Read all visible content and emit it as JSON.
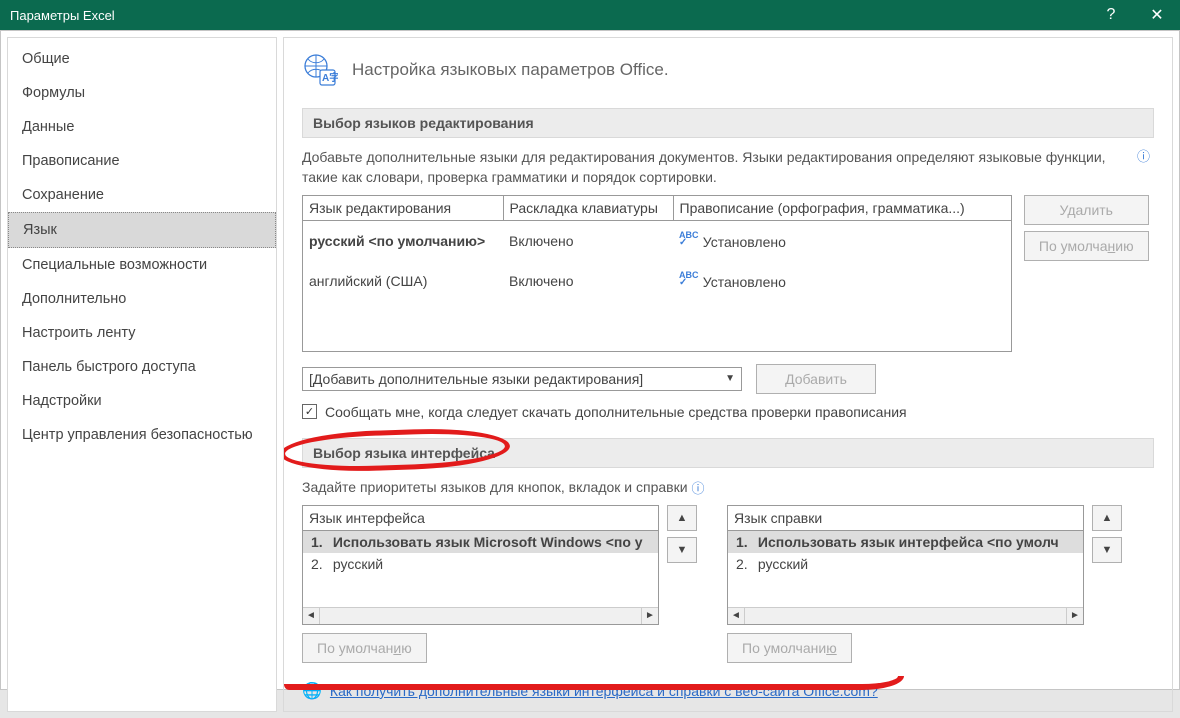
{
  "window": {
    "title": "Параметры Excel",
    "help_glyph": "?",
    "close_glyph": "✕"
  },
  "sidebar": {
    "items": [
      {
        "label": "Общие"
      },
      {
        "label": "Формулы"
      },
      {
        "label": "Данные"
      },
      {
        "label": "Правописание"
      },
      {
        "label": "Сохранение"
      },
      {
        "label": "Язык",
        "selected": true
      },
      {
        "label": "Специальные возможности"
      },
      {
        "label": "Дополнительно"
      },
      {
        "label": "Настроить ленту"
      },
      {
        "label": "Панель быстрого доступа"
      },
      {
        "label": "Надстройки"
      },
      {
        "label": "Центр управления безопасностью"
      }
    ]
  },
  "main": {
    "page_title": "Настройка языковых параметров Office.",
    "editing": {
      "section_title": "Выбор языков редактирования",
      "help_text": "Добавьте дополнительные языки для редактирования документов. Языки редактирования определяют языковые функции, такие как словари, проверка грамматики и порядок сортировки.",
      "columns": {
        "c1": "Язык редактирования",
        "c2": "Раскладка клавиатуры",
        "c3": "Правописание (орфография, грамматика...)"
      },
      "rows": [
        {
          "lang": "русский <по умолчанию>",
          "keyboard": "Включено",
          "spell": "Установлено",
          "default": true
        },
        {
          "lang": "английский (США)",
          "keyboard": "Включено",
          "spell": "Установлено",
          "default": false
        }
      ],
      "remove_btn": "Удалить",
      "default_btn_prefix": "По умолча",
      "default_btn_accel": "н",
      "default_btn_suffix": "ию",
      "add_combo": "[Добавить дополнительные языки редактирования]",
      "add_btn_accel": "Д",
      "add_btn_rest": "обавить",
      "notify_checkbox": "Сообщать мне, когда следует скачать дополнительные средства проверки правописания"
    },
    "ui_lang": {
      "section_title": "Выбор языка интерфейса",
      "help_text": "Задайте приоритеты языков для кнопок, вкладок и справки",
      "display_label": "Язык интерфейса",
      "help_label": "Язык справки",
      "display_items": [
        {
          "n": "1.",
          "text": "Использовать язык Microsoft Windows <по у",
          "selected": true
        },
        {
          "n": "2.",
          "text": "русский",
          "selected": false
        }
      ],
      "help_items": [
        {
          "n": "1.",
          "text": "Использовать язык интерфейса <по умолч",
          "selected": true
        },
        {
          "n": "2.",
          "text": "русский",
          "selected": false
        }
      ],
      "default_btn1_prefix": "По умолчан",
      "default_btn1_accel": "и",
      "default_btn1_suffix": "ю",
      "default_btn2_prefix": "По умолчани",
      "default_btn2_accel": "ю",
      "default_btn2_suffix": ""
    },
    "link_text": "Как получить дополнительные языки интерфейса и справки с веб-сайта Office.com?",
    "abc_glyph": "ABC"
  }
}
